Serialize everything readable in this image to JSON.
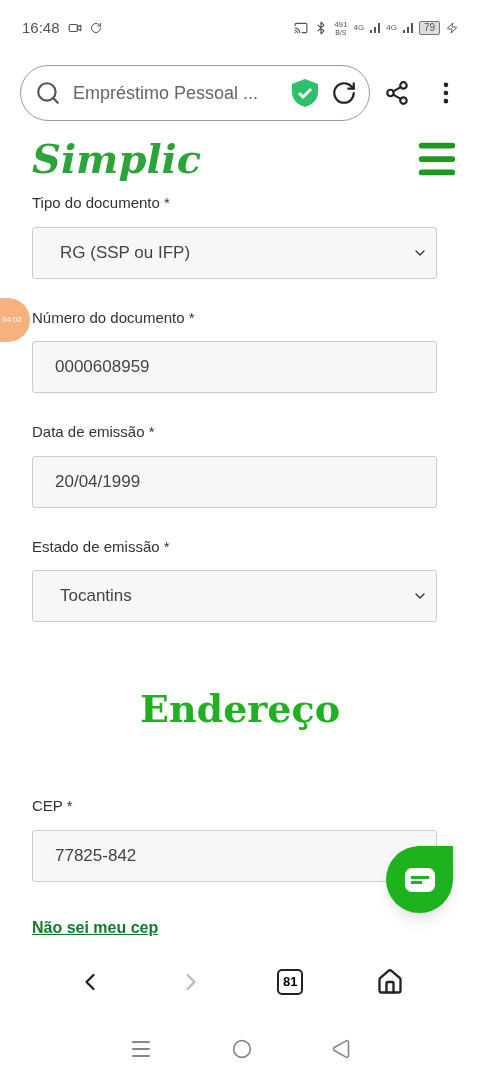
{
  "status_bar": {
    "time": "16:48",
    "speed_value": "491",
    "speed_unit": "B/S",
    "network_1": "4G",
    "network_2": "4G",
    "battery": "79"
  },
  "browser": {
    "url_text": "Empréstimo Pessoal ...",
    "secure": true
  },
  "site_header": {
    "logo": "Simplic"
  },
  "recorder_badge": "04:02",
  "fields": [
    {
      "kind": "select",
      "label": "Tipo do documento *",
      "value": "RG (SSP ou IFP)"
    },
    {
      "kind": "input",
      "label": "Número do documento *",
      "value": "0000608959"
    },
    {
      "kind": "input",
      "label": "Data de emissão *",
      "value": "20/04/1999"
    },
    {
      "kind": "select",
      "label": "Estado de emissão *",
      "value": "Tocantins"
    }
  ],
  "section_title": "Endereço",
  "address_fields": [
    {
      "kind": "input",
      "label": "CEP *",
      "value": "77825-842"
    }
  ],
  "link": "Não sei meu cep",
  "browser_nav": {
    "back_disabled": false,
    "forward_disabled": true,
    "tabs_count": "81"
  }
}
